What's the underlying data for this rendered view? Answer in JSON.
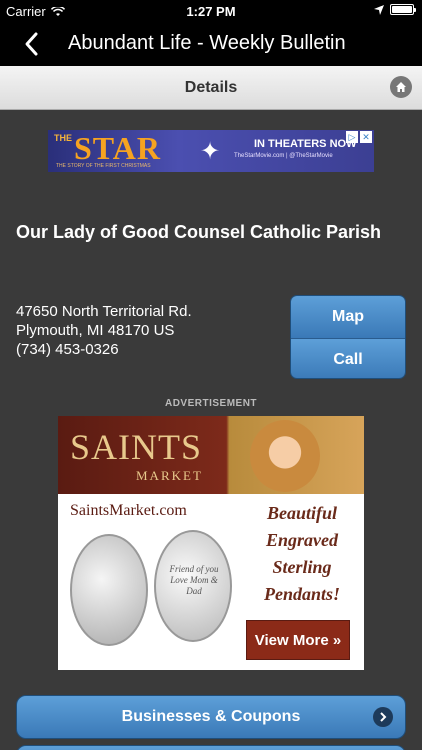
{
  "status_bar": {
    "carrier": "Carrier",
    "time": "1:27 PM",
    "battery_level": 1.0
  },
  "nav": {
    "title": "Abundant Life - Weekly Bulletin"
  },
  "subheader": {
    "title": "Details"
  },
  "banner_ad": {
    "the": "THE",
    "star": "STAR",
    "subtitle": "THE STORY OF THE FIRST CHRISTMAS",
    "headline": "IN THEATERS NOW",
    "web": "TheStarMovie.com | @TheStarMovie"
  },
  "listing": {
    "name": "Our Lady of Good Counsel Catholic Parish",
    "address_line1": "47650 North Territorial Rd.",
    "address_line2": "Plymouth, MI 48170 US",
    "phone": "(734) 453-0326",
    "map_label": "Map",
    "call_label": "Call"
  },
  "ad_label": "ADVERTISEMENT",
  "saints_ad": {
    "logo": "SAINTS",
    "market": "MARKET",
    "url": "SaintsMarket.com",
    "tagline": "Beautiful Engraved Sterling Pendants!",
    "engraving": "Friend of you Love Mom & Dad",
    "cta": "View More »"
  },
  "buttons": {
    "businesses": "Businesses & Coupons"
  }
}
